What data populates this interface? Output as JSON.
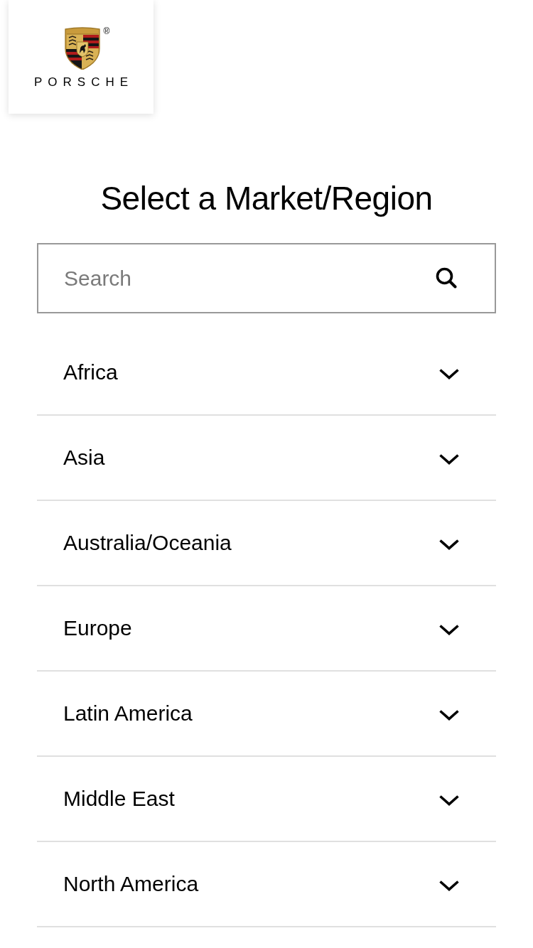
{
  "logo": {
    "wordmark": "PORSCHE",
    "registered_mark": "®"
  },
  "title": "Select a Market/Region",
  "search": {
    "placeholder": "Search"
  },
  "regions": [
    {
      "label": "Africa",
      "expanded": false
    },
    {
      "label": "Asia",
      "expanded": false
    },
    {
      "label": "Australia/Oceania",
      "expanded": false
    },
    {
      "label": "Europe",
      "expanded": false
    },
    {
      "label": "Latin America",
      "expanded": false
    },
    {
      "label": "Middle East",
      "expanded": false
    },
    {
      "label": "North America",
      "expanded": false
    }
  ]
}
